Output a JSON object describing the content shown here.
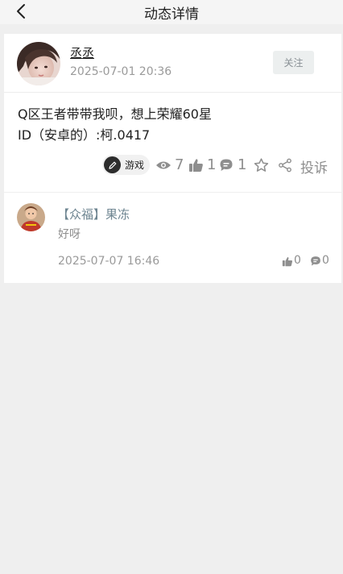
{
  "header": {
    "title": "动态详情",
    "back_icon": "chevron-left-icon"
  },
  "post": {
    "author": {
      "name": "丞丞",
      "avatar": "avatar-photo"
    },
    "time": "2025-07-01 20:36",
    "follow_label": "关注",
    "content_lines": [
      "Q区王者带带我呗，想上荣耀60星",
      "ID（安卓的）:柯.0417"
    ],
    "tag": {
      "label": "游戏",
      "icon": "pencil-icon"
    },
    "stats": {
      "views": "7",
      "likes": "1",
      "comments": "1"
    },
    "complain_label": "投诉"
  },
  "comments": [
    {
      "author": "【众福】果冻",
      "text": "好呀",
      "time": "2025-07-07 16:46",
      "likes": "0",
      "replies": "0"
    }
  ],
  "colors": {
    "page_bg": "#efefef",
    "card_bg": "#ffffff",
    "link_blue_gray": "#6e8591",
    "muted": "#8e8e8e"
  }
}
